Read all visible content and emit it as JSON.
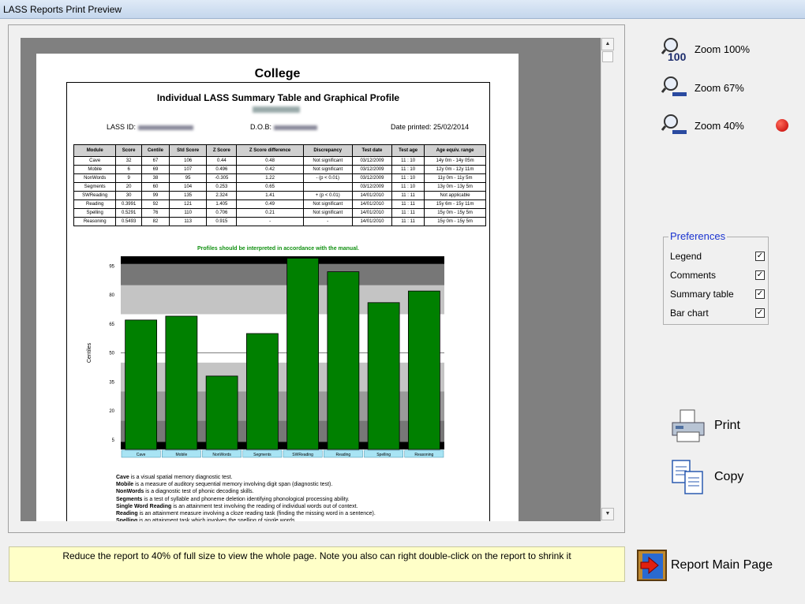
{
  "window": {
    "title": "LASS Reports Print Preview"
  },
  "report": {
    "page_title": "College",
    "heading": "Individual LASS Summary Table and Graphical Profile",
    "lass_id_label": "LASS ID:",
    "dob_label": "D.O.B:",
    "date_printed": "Date printed: 25/02/2014",
    "table": {
      "headers": [
        "Module",
        "Score",
        "Centile",
        "Std Score",
        "Z Score",
        "Z Score difference",
        "Discrepancy",
        "Test date",
        "Test age",
        "Age equiv. range"
      ],
      "rows": [
        [
          "Cave",
          "32",
          "67",
          "106",
          "0.44",
          "0.48",
          "Not significant",
          "03/12/2009",
          "11 : 10",
          "14y 0m - 14y 05m"
        ],
        [
          "Mobile",
          "6",
          "69",
          "107",
          "0.496",
          "0.42",
          "Not significant",
          "03/12/2009",
          "11 : 10",
          "12y 0m - 12y 11m"
        ],
        [
          "NonWords",
          "9",
          "38",
          "95",
          "-0.305",
          "1.22",
          "- (p < 0.01)",
          "03/12/2009",
          "11 : 10",
          "11y 0m - 11y 5m"
        ],
        [
          "Segments",
          "20",
          "60",
          "104",
          "0.253",
          "0.65",
          "",
          "03/12/2009",
          "11 : 10",
          "13y 0m - 13y 5m"
        ],
        [
          "SWReading",
          "30",
          "99",
          "135",
          "2.324",
          "1.41",
          "+ (p < 0.01)",
          "14/01/2010",
          "11 : 11",
          "Not applicable"
        ],
        [
          "Reading",
          "0.3991",
          "92",
          "121",
          "1.405",
          "0.49",
          "Not significant",
          "14/01/2010",
          "11 : 11",
          "15y 6m - 15y 11m"
        ],
        [
          "Spelling",
          "0.5291",
          "76",
          "110",
          "0.706",
          "0.21",
          "Not significant",
          "14/01/2010",
          "11 : 11",
          "15y 0m - 15y 5m"
        ],
        [
          "Reasoning",
          "0.5493",
          "82",
          "113",
          "0.915",
          "-",
          "-",
          "14/01/2010",
          "11 : 11",
          "15y 0m - 15y 5m"
        ]
      ]
    },
    "chart_note": "Profiles should be interpreted in accordance with the manual.",
    "descriptions": [
      {
        "term": "Cave",
        "text": " is a visual spatial memory diagnostic test."
      },
      {
        "term": "Mobile",
        "text": " is a measure of auditory sequential memory involving digit span (diagnostic test)."
      },
      {
        "term": "NonWords",
        "text": " is a diagnostic test of phonic decoding skills."
      },
      {
        "term": "Segments",
        "text": " is a test of syllable and phoneme deletion identifying phonological processing ability."
      },
      {
        "term": "Single Word Reading",
        "text": " is an attainment test involving the reading of individual words out of context."
      },
      {
        "term": "Reading",
        "text": " is an attainment measure involving a cloze reading task (finding the missing word in a sentence)."
      },
      {
        "term": "Spelling",
        "text": " is an attainment task which involves the spelling of single words."
      }
    ]
  },
  "chart_data": {
    "type": "bar",
    "categories": [
      "Cave",
      "Mobile",
      "NonWords",
      "Segments",
      "SWReading",
      "Reading",
      "Spelling",
      "Reasoning"
    ],
    "values": [
      67,
      69,
      38,
      60,
      99,
      92,
      76,
      82
    ],
    "ylabel": "Centiles",
    "yticks": [
      5,
      20,
      35,
      50,
      65,
      80,
      95
    ],
    "ylim": [
      0,
      100
    ],
    "bar_color": "#008000",
    "bands": [
      {
        "from": 0,
        "to": 4,
        "color": "#000000"
      },
      {
        "from": 4,
        "to": 15,
        "color": "#777777"
      },
      {
        "from": 15,
        "to": 30,
        "color": "#9a9a9a"
      },
      {
        "from": 30,
        "to": 45,
        "color": "#c4c4c4"
      },
      {
        "from": 45,
        "to": 55,
        "color": "#ffffff"
      },
      {
        "from": 55,
        "to": 70,
        "color": "#ffffff"
      },
      {
        "from": 70,
        "to": 85,
        "color": "#c4c4c4"
      },
      {
        "from": 85,
        "to": 96,
        "color": "#777777"
      },
      {
        "from": 96,
        "to": 100,
        "color": "#000000"
      }
    ]
  },
  "sidebar": {
    "zoom100": "Zoom 100%",
    "zoom67": "Zoom 67%",
    "zoom40": "Zoom 40%",
    "zoom100_badge": "100",
    "preferences": {
      "title": "Preferences",
      "items": [
        {
          "label": "Legend",
          "checked": true
        },
        {
          "label": "Comments",
          "checked": true
        },
        {
          "label": "Summary table",
          "checked": true
        },
        {
          "label": "Bar chart",
          "checked": true
        }
      ]
    },
    "print": "Print",
    "copy": "Copy",
    "main_page": "Report Main Page"
  },
  "status": {
    "message": "Reduce the report to 40% of full size to view the whole page. Note you also can right double-click on the report to shrink it"
  }
}
